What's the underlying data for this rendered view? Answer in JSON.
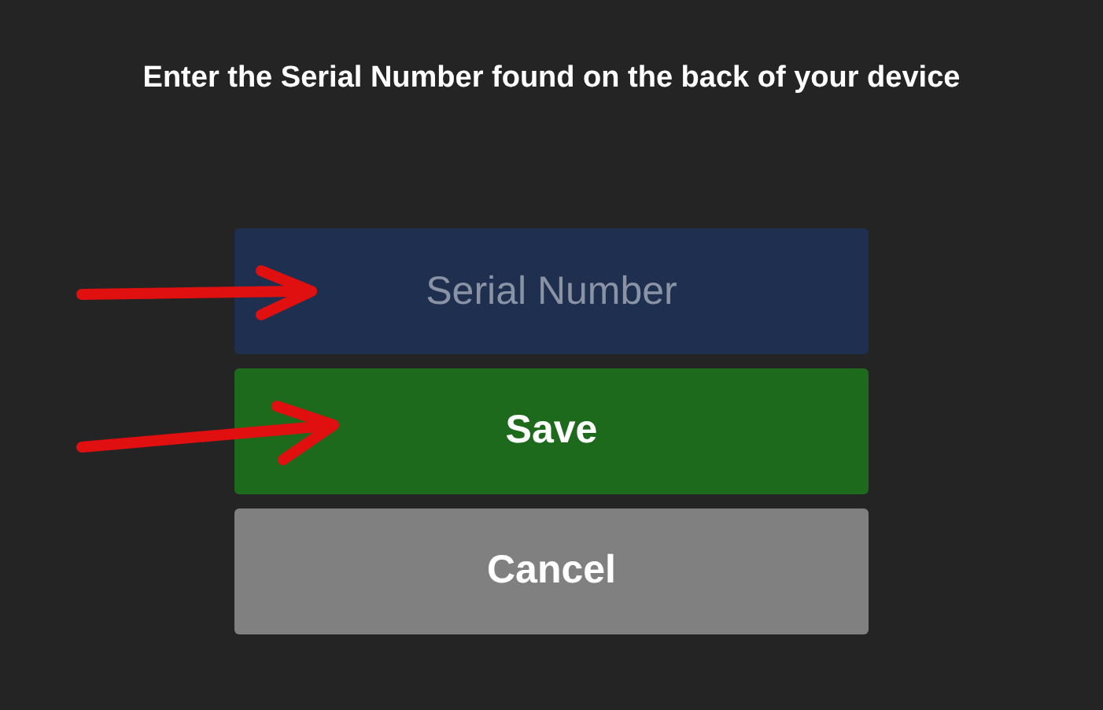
{
  "instruction": "Enter the Serial Number found on the back of your device",
  "serial_field": {
    "placeholder": "Serial Number"
  },
  "buttons": [
    {
      "label": "Save",
      "kind": "primary"
    },
    {
      "label": "Cancel",
      "kind": "secondary"
    }
  ]
}
